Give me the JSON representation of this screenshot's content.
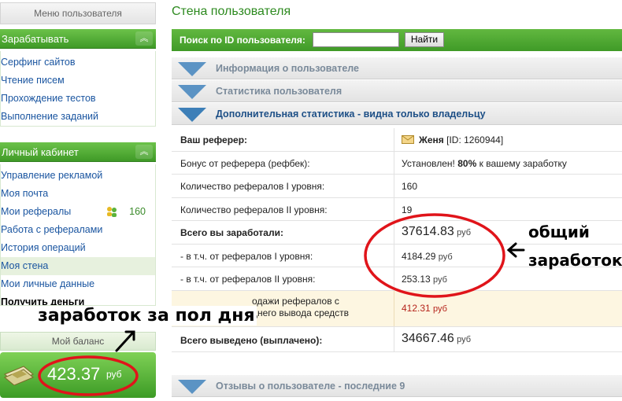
{
  "sidebar": {
    "menu_title": "Меню пользователя",
    "earn": {
      "title": "Зарабатывать",
      "items": [
        "Серфинг сайтов",
        "Чтение писем",
        "Прохождение тестов",
        "Выполнение заданий"
      ]
    },
    "cabinet": {
      "title": "Личный кабинет",
      "items": [
        "Управление рекламой",
        "Моя почта",
        "Мои рефералы",
        "Работа с рефералами",
        "История операций",
        "Моя стена",
        "Мои личные данные",
        "Получить деньги"
      ],
      "referrals_count": "160",
      "active_item": "Моя стена"
    },
    "balance": {
      "title": "Мой баланс",
      "value": "423.37",
      "currency": "руб"
    }
  },
  "main": {
    "page_title": "Стена пользователя",
    "search": {
      "label": "Поиск по ID пользователя:",
      "value": "",
      "button": "Найти"
    },
    "sections": {
      "info": "Информация о пользователе",
      "stats": "Статистика пользователя",
      "extra": "Дополнительная статистика - видна только владельцу",
      "reviews": "Отзывы о пользователе - последние 9"
    },
    "stats": {
      "referrer_label": "Ваш реферер:",
      "referrer_name": "Женя",
      "referrer_id": "[ID: 1260944]",
      "bonus_label": "Бонус от реферера (рефбек):",
      "bonus_prefix": "Установлен!",
      "bonus_percent": "80%",
      "bonus_suffix": "к вашему заработку",
      "ref1_label": "Количество рефералов I уровня:",
      "ref1_value": "160",
      "ref2_label": "Количество рефералов II уровня:",
      "ref2_value": "19",
      "earned_label": "Всего вы заработали:",
      "earned_value": "37614.83",
      "earned_cur": "руб",
      "earned_ref1_label": "- в т.ч. от рефералов I уровня:",
      "earned_ref1_value": "4184.29",
      "earned_ref1_cur": "руб",
      "earned_ref2_label": "- в т.ч. от рефералов II уровня:",
      "earned_ref2_value": "253.13",
      "earned_ref2_cur": "руб",
      "sales_label_1": "одажи рефералов с",
      "sales_label_2": "днего вывода средств",
      "sales_value": "412.31",
      "sales_cur": "руб",
      "withdrawn_label": "Всего выведено (выплачено):",
      "withdrawn_value": "34667.46",
      "withdrawn_cur": "руб"
    }
  },
  "annotations": {
    "total_line1": "общий",
    "total_line2": "заработок",
    "half_day": "заработок за пол дня"
  },
  "colors": {
    "green": "#3f9a27",
    "link_blue": "#1a55a0",
    "circle_red": "#e0141a"
  }
}
